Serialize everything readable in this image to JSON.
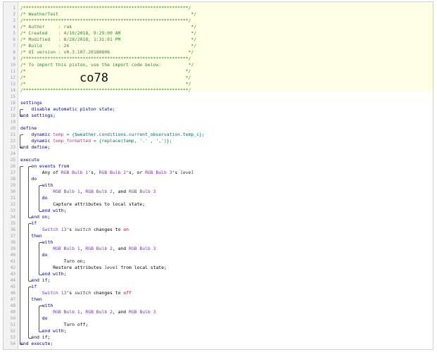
{
  "gutter": {
    "line_numbers": [
      "1",
      "2",
      "3",
      "4",
      "5",
      "6",
      "7",
      "8",
      "9",
      "10",
      "11",
      "12",
      "13",
      "14",
      "15",
      "16",
      "17",
      "18",
      "19",
      "20",
      "21",
      "22",
      "23",
      "24",
      "25",
      "26",
      "27",
      "28",
      "29",
      "30",
      "31",
      "32",
      "33",
      "34",
      "35",
      "36",
      "37",
      "38",
      "39",
      "40",
      "41",
      "42",
      "43",
      "44",
      "45",
      "46",
      "47",
      "48",
      "49",
      "50",
      "51",
      "52",
      "53",
      "54"
    ]
  },
  "header": {
    "border": "/*************************************************************/",
    "title": "/* WeatherTest                                                 */",
    "author": "/* Author     : rak                                            */",
    "created": "/* Created    : 4/10/2018, 9:29:00 AM                          */",
    "modified": "/* Modified   : 8/28/2018, 1:31:01 PM                          */",
    "build": "/* Build      : 24                                             */",
    "ui_version": "/* UI version : v0.3.107.20180806                             */",
    "import_note": "/* To import this piston, use the import code below:          */",
    "blank": "/*                                                           */",
    "import_code": "co78"
  },
  "code": {
    "settings": "settings",
    "disable_state": "disable automatic piston state;",
    "end_settings": "end settings;",
    "define": "define",
    "dynamic": "dynamic",
    "temp_var": "temp",
    "temp_expr": "= {$weather.conditions.current_observation.temp_c};",
    "temp_formatted_var": "temp_formatted",
    "temp_formatted_expr_a": "= {replace(temp, '.' , ',')};",
    "end_define": "end define;",
    "execute": "execute",
    "on_events_from": "on events from",
    "any_of": "Any of",
    "bulb1": "RGB Bulb 1",
    "bulb2": "RGB Bulb 2",
    "bulb3": "RGB Bulb 3",
    "apos_s": "'s,",
    "apos_s_or": "'s, or",
    "apos_s_plain": "'s",
    "level": "level",
    "do": "do",
    "with": "with",
    "comma": ",",
    "and": ", and",
    "capture": "Capture attributes to local state;",
    "end_with": "end with;",
    "end_on": "end on;",
    "if": "if",
    "switch13": "Switch 13",
    "switch_attr": "switch",
    "changes_to": "changes to",
    "on_val": "on",
    "off_val": "off",
    "then": "then",
    "turn_on": "Turn on;",
    "restore_a": "Restore attributes",
    "restore_b": "from local state;",
    "turn_off": "Turn off;",
    "end_if": "end if;",
    "end_execute": "end execute;"
  }
}
